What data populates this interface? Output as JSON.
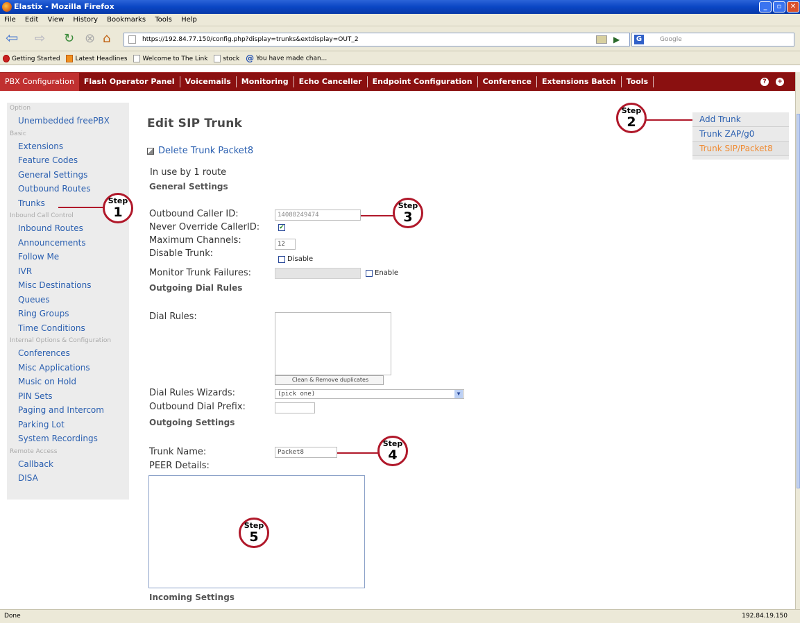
{
  "window": {
    "title": "Elastix - Mozilla Firefox"
  },
  "menu": [
    "File",
    "Edit",
    "View",
    "History",
    "Bookmarks",
    "Tools",
    "Help"
  ],
  "url": "https://192.84.77.150/config.php?display=trunks&extdisplay=OUT_2",
  "search_placeholder": "Google",
  "bookmarks": [
    "Getting Started",
    "Latest Headlines",
    "Welcome to The Link",
    "stock",
    "You have made chan..."
  ],
  "pbx_nav": [
    "PBX Configuration",
    "Flash Operator Panel",
    "Voicemails",
    "Monitoring",
    "Echo Canceller",
    "Endpoint Configuration",
    "Conference",
    "Extensions Batch",
    "Tools"
  ],
  "sidebar": [
    {
      "type": "header",
      "label": "Option"
    },
    {
      "type": "item",
      "label": "Unembedded freePBX"
    },
    {
      "type": "header",
      "label": "Basic"
    },
    {
      "type": "item",
      "label": "Extensions"
    },
    {
      "type": "item",
      "label": "Feature Codes"
    },
    {
      "type": "item",
      "label": "General Settings"
    },
    {
      "type": "item",
      "label": "Outbound Routes"
    },
    {
      "type": "item",
      "label": "Trunks"
    },
    {
      "type": "header",
      "label": "Inbound Call Control"
    },
    {
      "type": "item",
      "label": "Inbound Routes"
    },
    {
      "type": "item",
      "label": "Announcements"
    },
    {
      "type": "item",
      "label": "Follow Me"
    },
    {
      "type": "item",
      "label": "IVR"
    },
    {
      "type": "item",
      "label": "Misc Destinations"
    },
    {
      "type": "item",
      "label": "Queues"
    },
    {
      "type": "item",
      "label": "Ring Groups"
    },
    {
      "type": "item",
      "label": "Time Conditions"
    },
    {
      "type": "header",
      "label": "Internal Options & Configuration"
    },
    {
      "type": "item",
      "label": "Conferences"
    },
    {
      "type": "item",
      "label": "Misc Applications"
    },
    {
      "type": "item",
      "label": "Music on Hold"
    },
    {
      "type": "item",
      "label": "PIN Sets"
    },
    {
      "type": "item",
      "label": "Paging and Intercom"
    },
    {
      "type": "item",
      "label": "Parking Lot"
    },
    {
      "type": "item",
      "label": "System Recordings"
    },
    {
      "type": "header",
      "label": "Remote Access"
    },
    {
      "type": "item",
      "label": "Callback"
    },
    {
      "type": "item",
      "label": "DISA"
    }
  ],
  "main": {
    "title": "Edit SIP Trunk",
    "delete_link": "Delete Trunk Packet8",
    "in_use": "In use by 1 route",
    "general_settings": "General Settings",
    "outbound_caller_id_label": "Outbound Caller ID:",
    "outbound_caller_id_value": "14088249474",
    "never_override_label": "Never Override CallerID:",
    "never_override_mark": "✔",
    "max_channels_label": "Maximum Channels:",
    "max_channels_value": "12",
    "disable_trunk_label": "Disable Trunk:",
    "disable_label": "Disable",
    "monitor_label": "Monitor Trunk Failures:",
    "enable_label": "Enable",
    "outgoing_dial_rules": "Outgoing Dial Rules",
    "dial_rules_label": "Dial Rules:",
    "clean_button": "Clean & Remove duplicates",
    "dial_wizards_label": "Dial Rules Wizards:",
    "dial_wizards_value": "(pick one)",
    "outbound_prefix_label": "Outbound Dial Prefix:",
    "outgoing_settings": "Outgoing Settings",
    "trunk_name_label": "Trunk Name:",
    "trunk_name_value": "Packet8",
    "peer_details_label": "PEER Details:",
    "incoming_settings": "Incoming Settings"
  },
  "trunk_list": [
    "Add Trunk",
    "Trunk ZAP/g0",
    "Trunk SIP/Packet8"
  ],
  "steps": [
    {
      "word": "Step",
      "num": "1"
    },
    {
      "word": "Step",
      "num": "2"
    },
    {
      "word": "Step",
      "num": "3"
    },
    {
      "word": "Step",
      "num": "4"
    },
    {
      "word": "Step",
      "num": "5"
    }
  ],
  "status": {
    "left": "Done",
    "right": "192.84.19.150"
  },
  "colors": {
    "nav_bg": "#8a1010",
    "link": "#2a5fb0",
    "current": "#f08a30",
    "step_ring": "#b0182a"
  }
}
